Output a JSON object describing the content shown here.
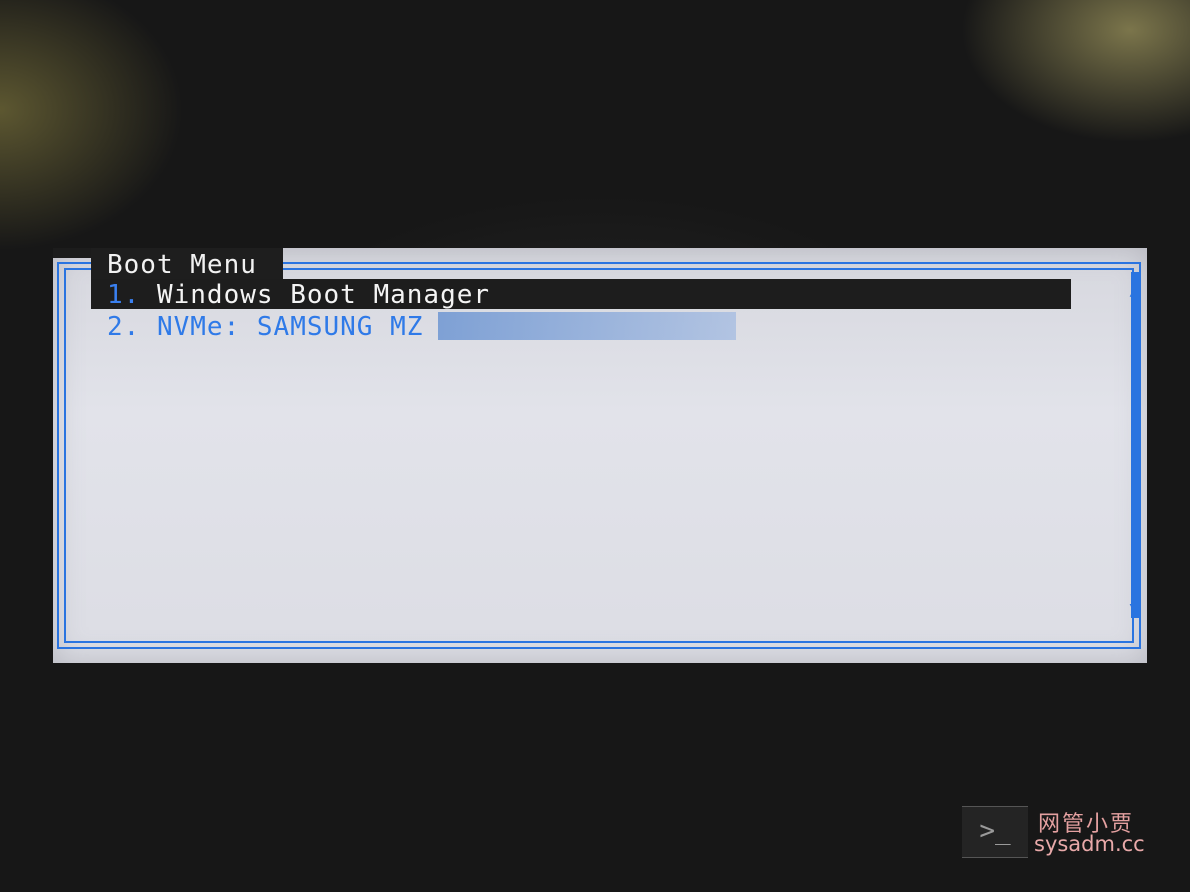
{
  "menu": {
    "title": "Boot Menu",
    "items": [
      {
        "number": "1.",
        "label": "Windows Boot Manager",
        "selected": true
      },
      {
        "number": "2.",
        "label": "NVMe: SAMSUNG MZ",
        "selected": false
      }
    ]
  },
  "scrollbar": {
    "up_icon": "▲",
    "down_icon": "▼"
  },
  "watermark": {
    "prompt_glyph": ">_",
    "chinese_text": "网管小贾",
    "domain": "sysadm.cc"
  },
  "colors": {
    "accent_blue": "#2a74e0",
    "panel_gray": "#dcdde4",
    "selected_bg": "#1d1d1d"
  }
}
